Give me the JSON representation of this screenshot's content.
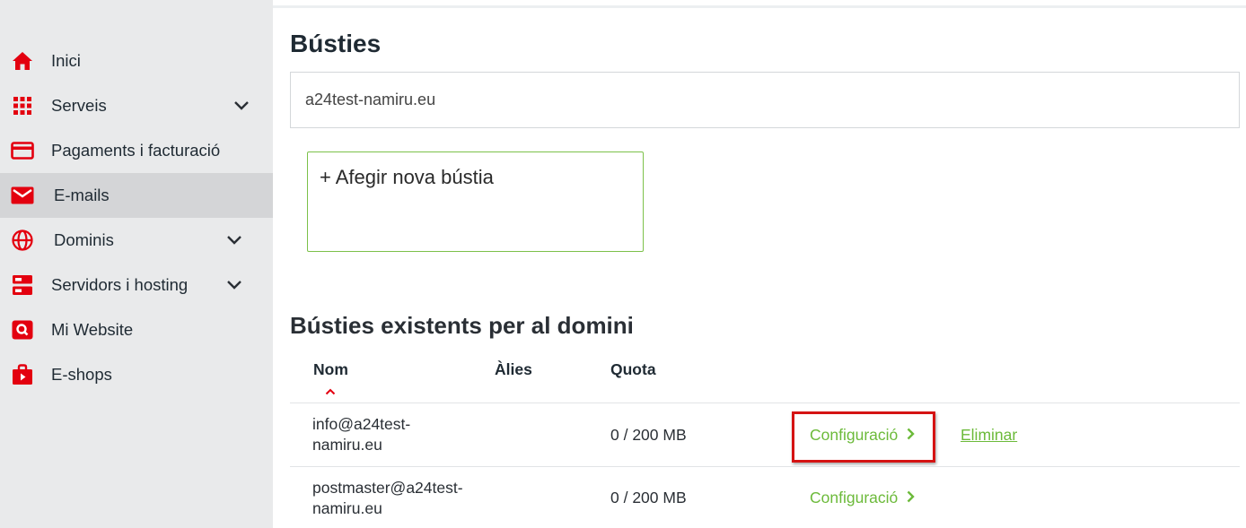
{
  "sidebar": {
    "items": [
      {
        "label": "Inici",
        "icon": "home-icon",
        "has_chevron": false,
        "active": false
      },
      {
        "label": "Serveis",
        "icon": "grid-icon",
        "has_chevron": true,
        "active": false
      },
      {
        "label": "Pagaments i facturació",
        "icon": "credit-card-icon",
        "has_chevron": false,
        "active": false
      },
      {
        "label": "E-mails",
        "icon": "envelope-icon",
        "has_chevron": false,
        "active": true
      },
      {
        "label": "Dominis",
        "icon": "globe-icon",
        "has_chevron": true,
        "active": false
      },
      {
        "label": "Servidors i hosting",
        "icon": "server-icon",
        "has_chevron": true,
        "active": false
      },
      {
        "label": "Mi Website",
        "icon": "search-window-icon",
        "has_chevron": false,
        "active": false
      },
      {
        "label": "E-shops",
        "icon": "shopping-bag-icon",
        "has_chevron": false,
        "active": false
      }
    ]
  },
  "main": {
    "title": "Bústies",
    "domain": "a24test-namiru.eu",
    "add_mailbox_label": "+ Afegir nova bústia",
    "section_title": "Bústies existents per al domini",
    "table": {
      "headers": {
        "name": "Nom",
        "alias": "Àlies",
        "quota": "Quota"
      },
      "sort": {
        "column": "Nom",
        "direction": "ascending"
      },
      "rows": [
        {
          "email_line1": "info@a24test-",
          "email_line2": "namiru.eu",
          "alias": "",
          "quota": "0 / 200 MB",
          "config_label": "Configuració",
          "delete_label": "Eliminar"
        },
        {
          "email_line1": "postmaster@a24test-",
          "email_line2": "namiru.eu",
          "alias": "",
          "quota": "0 / 200 MB",
          "config_label": "Configuració"
        }
      ]
    }
  },
  "colors": {
    "brand_red": "#e3000f",
    "link_green": "#6cba3a",
    "card_border_green": "#7cc14a",
    "highlight_red": "#d51313",
    "sidebar_bg": "#e9eaeb",
    "sidebar_active_bg": "#d4d5d7"
  }
}
